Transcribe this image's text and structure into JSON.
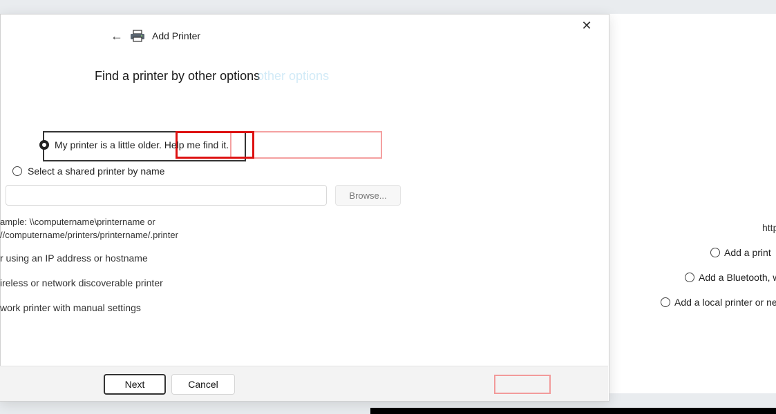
{
  "window": {
    "title": "Add Printer",
    "close_glyph": "✕",
    "back_glyph": "←"
  },
  "heading": "Find a printer by other options",
  "heading_ghost": "other options",
  "options": {
    "older": "My printer is a little older. Help me find it.",
    "shared": "Select a shared printer by name",
    "tcp_ip": "Add a printer using an IP address or hostname",
    "bluetooth": "Add a Bluetooth, wireless or network discoverable printer",
    "local": "Add a local printer or network printer with manual settings"
  },
  "left_fragments": {
    "tcp_ip": "r using an IP address or hostname",
    "bluetooth": "ireless or network discoverable printer",
    "local": "work printer with manual settings"
  },
  "right_fragments": {
    "tcp_ip": "Add a print",
    "bluetooth": "Add a Bluetooth, w",
    "local": "Add a local printer or net"
  },
  "shared_input": {
    "value": "",
    "placeholder": ""
  },
  "browse_label": "Browse...",
  "example": {
    "line1": "ample: \\\\computername\\printername or",
    "line2": "//computername/printers/printername/.printer",
    "right_fragment": "http:"
  },
  "footer": {
    "next_label": "Next",
    "cancel_label": "Cancel"
  },
  "colors": {
    "selection_red": "#dd1111",
    "selection_pink": "#f4a0a0",
    "heading_ghost": "#9ad2ee"
  }
}
